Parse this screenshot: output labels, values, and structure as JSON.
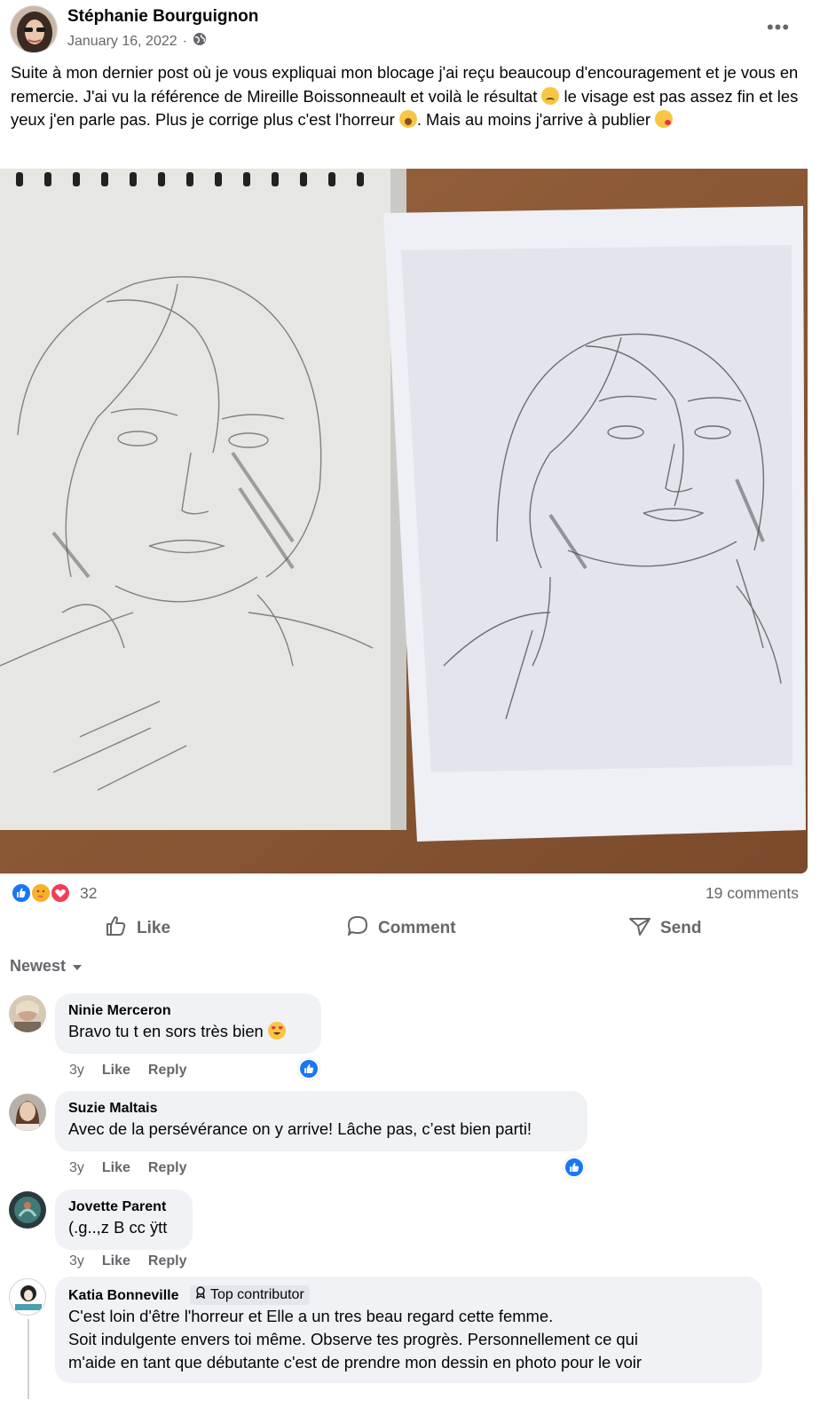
{
  "post": {
    "author": "Stéphanie Bourguignon",
    "date": "January 16, 2022",
    "date_separator": "·",
    "privacy_icon": "globe-icon",
    "more_icon": "more-horizontal-icon",
    "more_label": "•••",
    "text_1": "Suite à mon dernier post où je vous expliquai mon blocage j'ai reçu beaucoup d'encouragement et je vous en remercie. J'ai vu la référence de Mireille Boissonneault et voilà le résultat ",
    "text_2": " le visage est pas assez fin et les yeux j'en parle pas. Plus je corrige plus c'est l'horreur ",
    "text_3": ". Mais au moins j'arrive à publier ",
    "emoji_1": "disappointed-face",
    "emoji_2": "loudly-crying-face",
    "emoji_3": "face-blowing-kiss"
  },
  "reactions": {
    "icons": [
      "like-reaction-icon",
      "care-reaction-icon",
      "love-reaction-icon"
    ],
    "count": "32",
    "comments_count": "19 comments"
  },
  "actions": {
    "like": "Like",
    "comment": "Comment",
    "send": "Send"
  },
  "sort": {
    "label": "Newest"
  },
  "comments": [
    {
      "name": "Ninie Merceron",
      "text": "Bravo tu t en sors très bien",
      "emoji": "heart-eyes",
      "age": "3y",
      "like": "Like",
      "reply": "Reply",
      "reaction": "like"
    },
    {
      "name": "Suzie Maltais",
      "text": "Avec de la persévérance on y arrive! Lâche pas, c’est bien parti!",
      "age": "3y",
      "like": "Like",
      "reply": "Reply",
      "reaction": "like"
    },
    {
      "name": "Jovette Parent",
      "text": "(.g..,z B cc ÿtt",
      "age": "3y",
      "like": "Like",
      "reply": "Reply"
    },
    {
      "name": "Katia Bonneville",
      "badge": "Top contributor",
      "line_1": "C'est loin d'être l'horreur et Elle a un tres beau regard cette femme.",
      "line_2": "Soit indulgente envers toi même. Observe tes progrès. Personnellement ce qui",
      "line_3": "m'aide en tant que débutante c'est de prendre mon dessin en photo pour le voir"
    }
  ],
  "colors": {
    "like_blue": "#1877f2",
    "love_red": "#f33e58",
    "care_yellow": "#f7b125",
    "secondary_text": "#65676b",
    "bubble_bg": "#f0f2f5"
  }
}
